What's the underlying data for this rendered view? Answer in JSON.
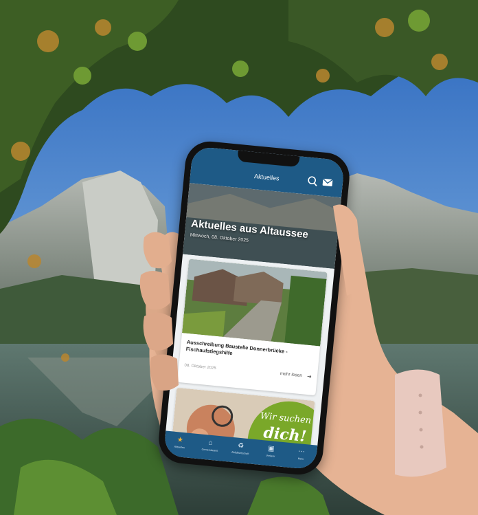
{
  "colors": {
    "sky": "#3d79c7",
    "app_primary": "#1e5a86",
    "accent_green": "#7aa829",
    "active_tab": "#f2b233"
  },
  "app": {
    "header_title": "Aktuelles",
    "header_icons": [
      "search-icon",
      "mail-icon"
    ]
  },
  "hero": {
    "title": "Aktuelles aus Altaussee",
    "date": "Mittwoch, 08. Oktober 2025"
  },
  "cards": [
    {
      "title": "Ausschreibung Baustelle Donnerbrücke - Fischaufstiegshilfe",
      "date": "08. Oktober 2025",
      "more": "mehr lesen",
      "more_icon": "arrow-right-icon"
    },
    {
      "text_line1": "Wir suchen",
      "text_line2": "dich!"
    }
  ],
  "tabs": [
    {
      "label": "Aktuelles",
      "icon": "star-icon",
      "active": true
    },
    {
      "label": "Gemeindeamt",
      "icon": "home-icon",
      "active": false
    },
    {
      "label": "Abfallwirtschaft",
      "icon": "recycle-icon",
      "active": false
    },
    {
      "label": "Verkehr",
      "icon": "car-icon",
      "active": false
    },
    {
      "label": "Mehr",
      "icon": "more-icon",
      "active": false
    }
  ]
}
